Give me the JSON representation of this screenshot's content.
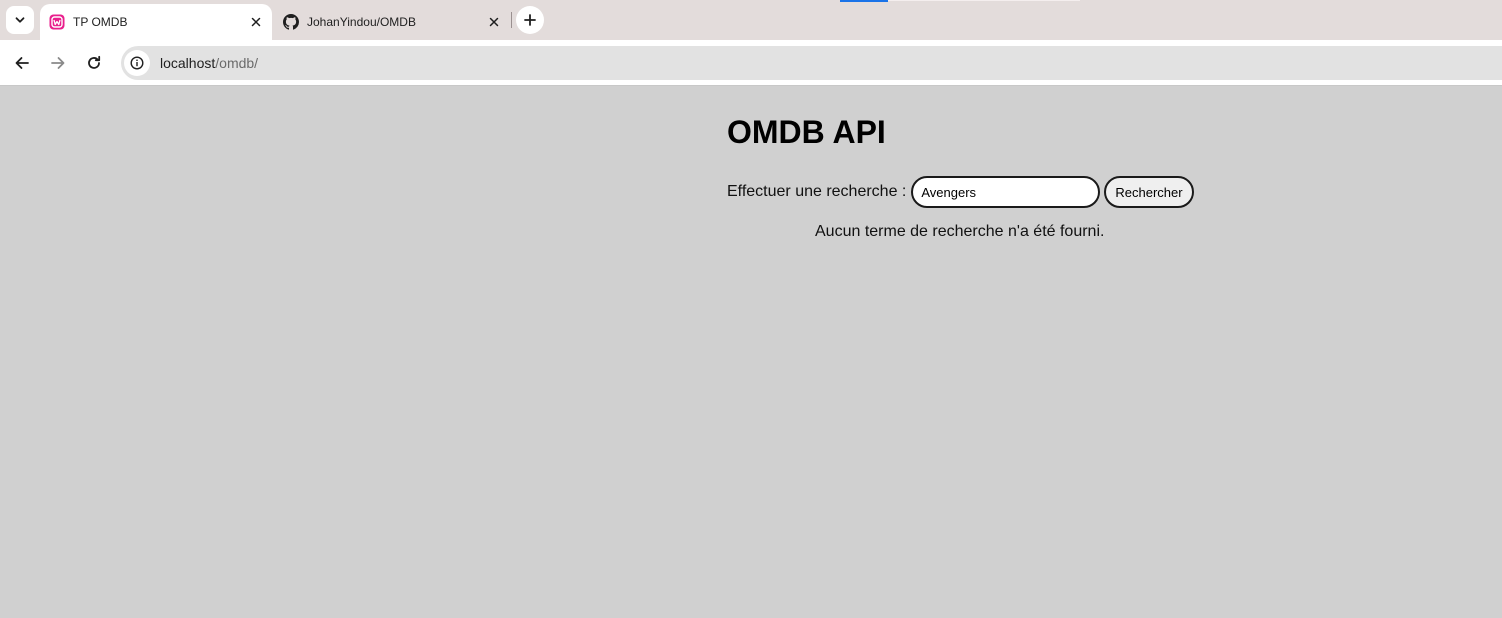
{
  "browser": {
    "tabs": [
      {
        "title": "TP OMDB",
        "icon": "wamp-icon",
        "active": true
      },
      {
        "title": "JohanYindou/OMDB",
        "icon": "github-icon",
        "active": false
      }
    ],
    "address": {
      "host": "localhost",
      "path": "/omdb/"
    }
  },
  "page": {
    "title": "OMDB API",
    "search": {
      "label": "Effectuer une recherche :",
      "value": "Avengers",
      "button_label": "Rechercher"
    },
    "message": "Aucun terme de recherche n'a été fourni."
  },
  "colors": {
    "page_background": "#d0d0d0",
    "tab_strip": "#e3dcdb",
    "wamp_pink": "#e91e8c"
  }
}
